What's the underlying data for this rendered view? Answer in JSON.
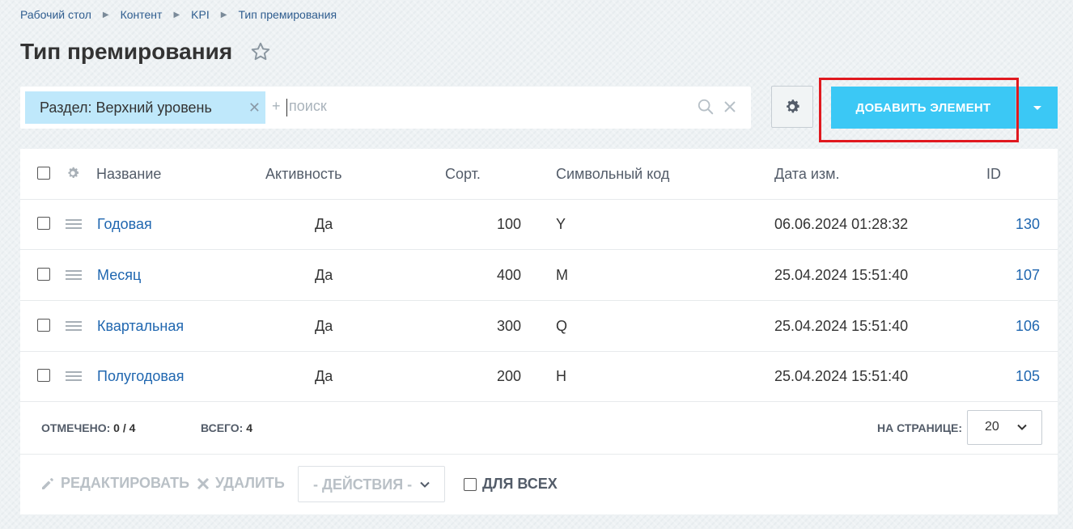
{
  "breadcrumb": [
    "Рабочий стол",
    "Контент",
    "KPI",
    "Тип премирования"
  ],
  "page_title": "Тип премирования",
  "filter": {
    "chip_label": "Раздел: Верхний уровень",
    "plus": "+",
    "search_placeholder": "поиск"
  },
  "toolbar": {
    "add_label": "ДОБАВИТЬ ЭЛЕМЕНТ"
  },
  "table": {
    "headers": [
      "Название",
      "Активность",
      "Сорт.",
      "Символьный код",
      "Дата изм.",
      "ID"
    ],
    "rows": [
      {
        "name": "Годовая",
        "active": "Да",
        "sort": "100",
        "code": "Y",
        "date": "06.06.2024 01:28:32",
        "id": "130"
      },
      {
        "name": "Месяц",
        "active": "Да",
        "sort": "400",
        "code": "M",
        "date": "25.04.2024 15:51:40",
        "id": "107"
      },
      {
        "name": "Квартальная",
        "active": "Да",
        "sort": "300",
        "code": "Q",
        "date": "25.04.2024 15:51:40",
        "id": "106"
      },
      {
        "name": "Полугодовая",
        "active": "Да",
        "sort": "200",
        "code": "H",
        "date": "25.04.2024 15:51:40",
        "id": "105"
      }
    ]
  },
  "footer": {
    "marked_label": "ОТМЕЧЕНО:",
    "marked_value": "0 / 4",
    "total_label": "ВСЕГО:",
    "total_value": "4",
    "per_page_label": "НА СТРАНИЦЕ:",
    "per_page_value": "20"
  },
  "actions": {
    "edit": "РЕДАКТИРОВАТЬ",
    "delete": "УДАЛИТЬ",
    "select": "- ДЕЙСТВИЯ -",
    "for_all": "ДЛЯ ВСЕХ"
  },
  "colors": {
    "accent": "#3bc8f5",
    "link": "#2067b0",
    "highlight": "#e0191f"
  }
}
